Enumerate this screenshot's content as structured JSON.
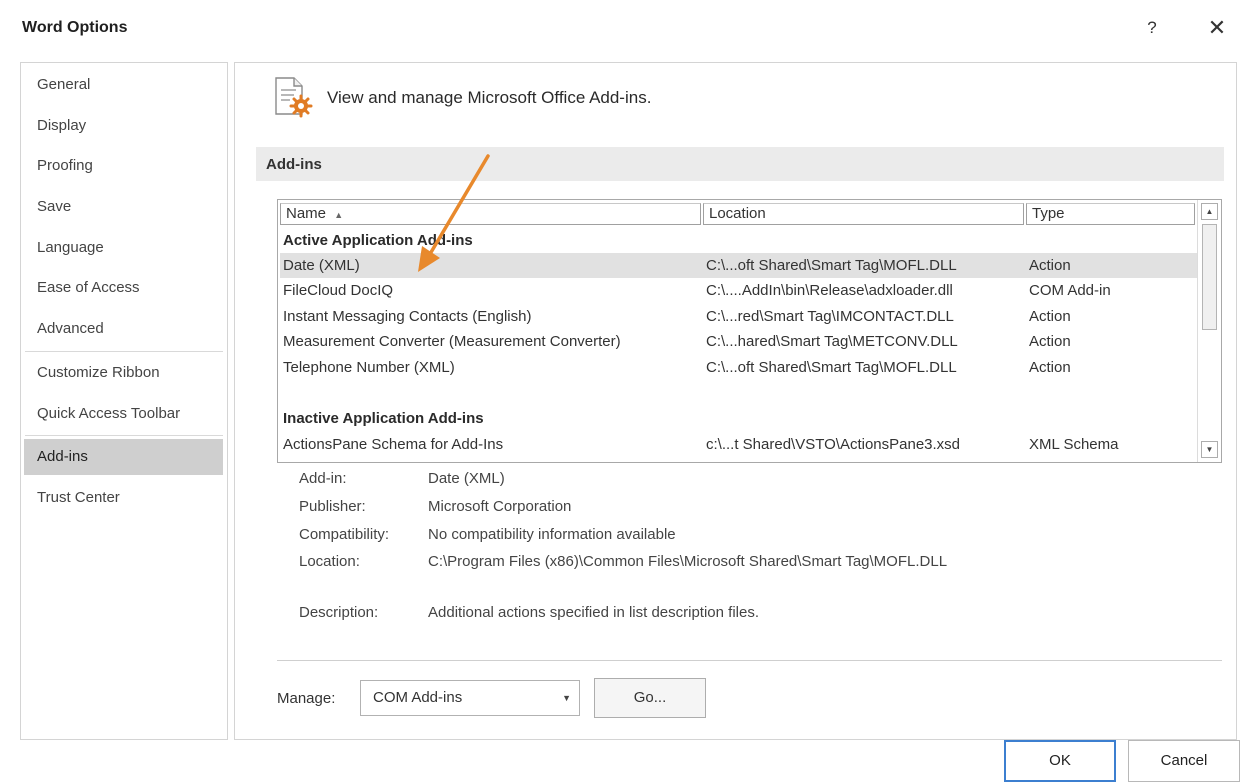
{
  "window": {
    "title": "Word Options",
    "help_glyph": "?",
    "close_glyph": "✕"
  },
  "nav": {
    "items": [
      {
        "label": "General"
      },
      {
        "label": "Display"
      },
      {
        "label": "Proofing"
      },
      {
        "label": "Save"
      },
      {
        "label": "Language"
      },
      {
        "label": "Ease of Access"
      },
      {
        "label": "Advanced"
      },
      {
        "label": "Customize Ribbon"
      },
      {
        "label": "Quick Access Toolbar"
      },
      {
        "label": "Add-ins",
        "selected": true
      },
      {
        "label": "Trust Center"
      }
    ]
  },
  "main": {
    "header_icon": "addins-gear-icon",
    "header_text": "View and manage Microsoft Office Add-ins.",
    "section_title": "Add-ins",
    "columns": {
      "name": "Name",
      "location": "Location",
      "type": "Type",
      "sort_glyph": "▲"
    },
    "rows": [
      {
        "kind": "group",
        "name": "Active Application Add-ins",
        "location": "",
        "type": ""
      },
      {
        "kind": "item",
        "selected": true,
        "name": "Date (XML)",
        "location": "C:\\...oft Shared\\Smart Tag\\MOFL.DLL",
        "type": "Action"
      },
      {
        "kind": "item",
        "name": "FileCloud DocIQ",
        "location": "C:\\....AddIn\\bin\\Release\\adxloader.dll",
        "type": "COM Add-in"
      },
      {
        "kind": "item",
        "name": "Instant Messaging Contacts (English)",
        "location": "C:\\...red\\Smart Tag\\IMCONTACT.DLL",
        "type": "Action"
      },
      {
        "kind": "item",
        "name": "Measurement Converter (Measurement Converter)",
        "location": "C:\\...hared\\Smart Tag\\METCONV.DLL",
        "type": "Action"
      },
      {
        "kind": "item",
        "name": "Telephone Number (XML)",
        "location": "C:\\...oft Shared\\Smart Tag\\MOFL.DLL",
        "type": "Action"
      },
      {
        "kind": "spacer",
        "name": "",
        "location": "",
        "type": ""
      },
      {
        "kind": "group",
        "name": "Inactive Application Add-ins",
        "location": "",
        "type": ""
      },
      {
        "kind": "item",
        "name": "ActionsPane Schema for Add-Ins",
        "location": "c:\\...t Shared\\VSTO\\ActionsPane3.xsd",
        "type": "XML Schema"
      }
    ],
    "scroll_up_glyph": "▲",
    "scroll_down_glyph": "▼",
    "details": {
      "addin_label": "Add-in:",
      "addin_value": "Date (XML)",
      "publisher_label": "Publisher:",
      "publisher_value": "Microsoft Corporation",
      "compat_label": "Compatibility:",
      "compat_value": "No compatibility information available",
      "location_label": "Location:",
      "location_value": "C:\\Program Files (x86)\\Common Files\\Microsoft Shared\\Smart Tag\\MOFL.DLL",
      "description_label": "Description:",
      "description_value": "Additional actions specified in list description files."
    },
    "manage": {
      "label": "Manage:",
      "selected": "COM Add-ins",
      "arrow_glyph": "▼",
      "go_label": "Go..."
    }
  },
  "footer": {
    "ok_label": "OK",
    "cancel_label": "Cancel"
  },
  "colors": {
    "annotation_arrow": "#e8892c",
    "selected_nav": "#cfcfcf",
    "ok_border": "#3c7fd0"
  }
}
